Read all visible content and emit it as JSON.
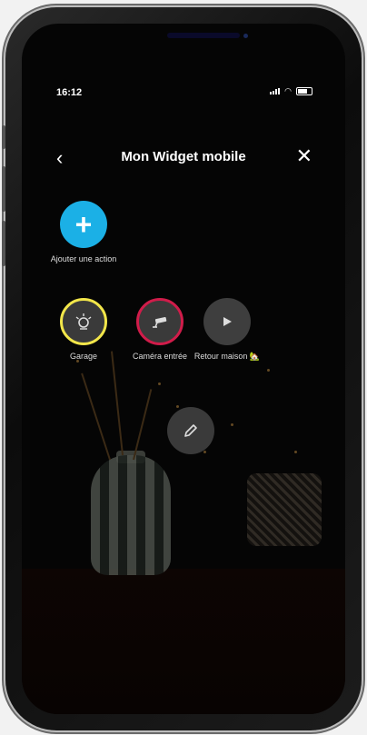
{
  "status": {
    "time": "16:12"
  },
  "header": {
    "title": "Mon Widget mobile"
  },
  "actions": {
    "add": {
      "label": "Ajouter une action"
    },
    "garage": {
      "label": "Garage",
      "ring_color": "#f2e64a"
    },
    "camera": {
      "label": "Caméra entrée",
      "ring_color": "#d01c4a"
    },
    "scenario": {
      "label": "Retour maison 🏡"
    }
  },
  "colors": {
    "accent": "#1bb0e6",
    "background": "#050505"
  }
}
